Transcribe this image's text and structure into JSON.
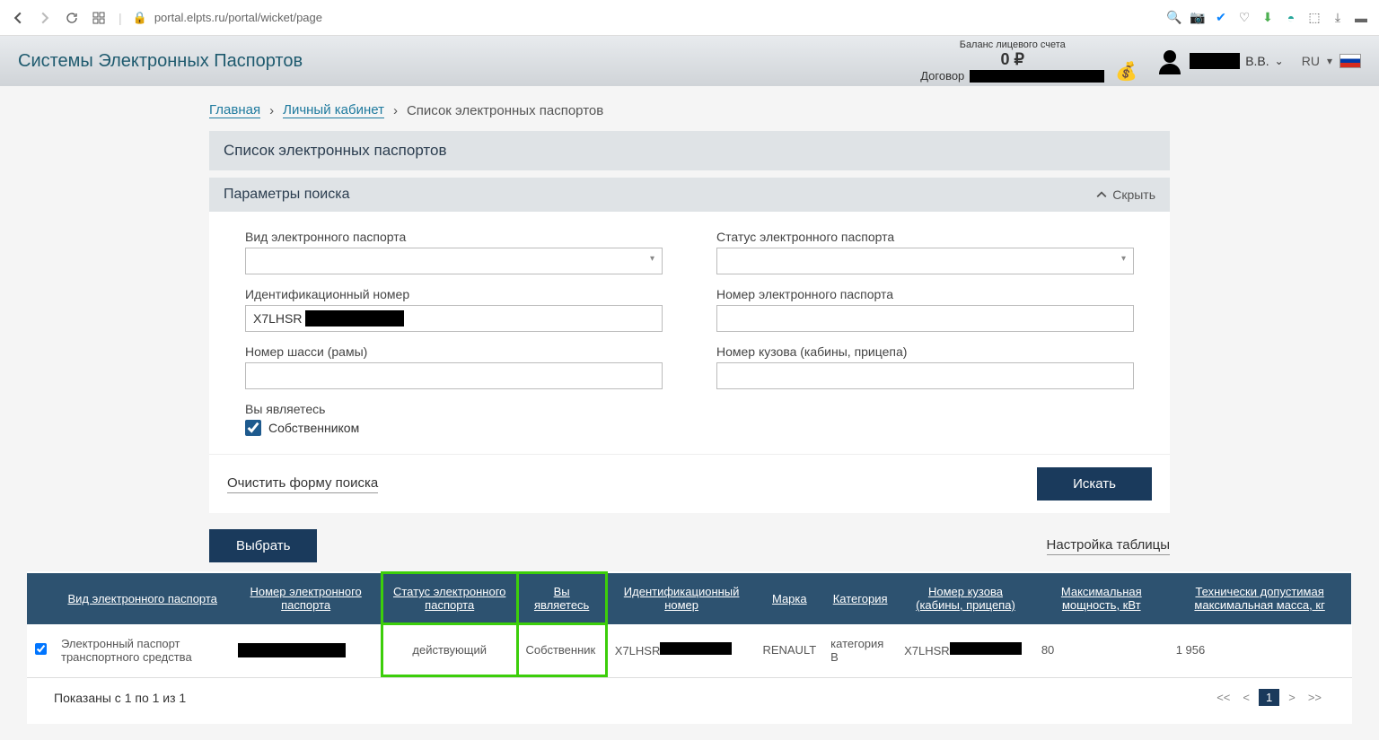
{
  "browser": {
    "url": "portal.elpts.ru/portal/wicket/page"
  },
  "header": {
    "site_title": "Системы Электронных Паспортов",
    "balance_label": "Баланс лицевого счета",
    "balance_value": "0 ₽",
    "contract_label": "Договор",
    "user_initials": "В.В.",
    "lang": "RU"
  },
  "breadcrumb": {
    "home": "Главная",
    "cabinet": "Личный кабинет",
    "current": "Список электронных паспортов"
  },
  "panel": {
    "title": "Список электронных паспортов",
    "params_title": "Параметры поиска",
    "toggle": "Скрыть"
  },
  "form": {
    "type_label": "Вид электронного паспорта",
    "status_label": "Статус электронного паспорта",
    "id_label": "Идентификационный номер",
    "id_value_prefix": "X7LHSR",
    "epnum_label": "Номер электронного паспорта",
    "chassis_label": "Номер шасси (рамы)",
    "body_label": "Номер кузова (кабины, прицепа)",
    "youare_label": "Вы являетесь",
    "owner_checkbox": "Собственником",
    "clear": "Очистить форму поиска",
    "search": "Искать"
  },
  "controls": {
    "select": "Выбрать",
    "table_settings": "Настройка таблицы"
  },
  "table": {
    "headers": {
      "type": "Вид электронного паспорта",
      "number": "Номер электронного паспорта",
      "status": "Статус электронного паспорта",
      "youare": "Вы являетесь",
      "id": "Идентификационный номер",
      "brand": "Марка",
      "category": "Категория",
      "body": "Номер кузова (кабины, прицепа)",
      "power": "Максимальная мощность, кВт",
      "mass": "Технически допустимая максимальная масса, кг"
    },
    "row": {
      "type": "Электронный паспорт транспортного средства",
      "status": "действующий",
      "youare": "Собственник",
      "id_prefix": "X7LHSR",
      "brand": "RENAULT",
      "category": "категория B",
      "body_prefix": "X7LHSR",
      "power": "80",
      "mass": "1 956"
    }
  },
  "footer": {
    "shown": "Показаны с 1 по 1 из 1",
    "page": "1"
  }
}
